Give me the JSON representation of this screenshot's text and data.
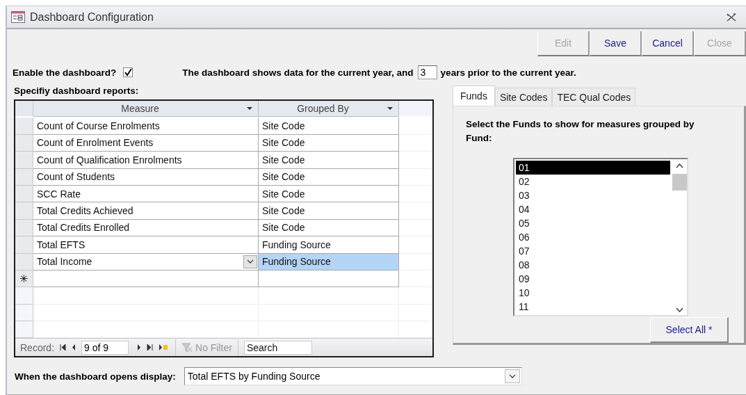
{
  "window": {
    "title": "Dashboard Configuration"
  },
  "buttons": [
    {
      "label": "Edit",
      "disabled": true
    },
    {
      "label": "Save",
      "disabled": false
    },
    {
      "label": "Cancel",
      "disabled": false
    },
    {
      "label": "Close",
      "disabled": true
    }
  ],
  "enable": {
    "label": "Enable the dashboard?",
    "checked": true
  },
  "years": {
    "before": "The dashboard shows data for the current year, and",
    "value": "3",
    "after": "years prior to the current year."
  },
  "reports": {
    "label": "Specifiy dashboard reports:",
    "columns": [
      "Measure",
      "Grouped By"
    ],
    "rows": [
      {
        "measure": "Count of Course Enrolments",
        "grouped_by": "Site Code",
        "selected": false
      },
      {
        "measure": "Count of Enrolment Events",
        "grouped_by": "Site Code",
        "selected": false
      },
      {
        "measure": "Count of Qualification Enrolments",
        "grouped_by": "Site Code",
        "selected": false
      },
      {
        "measure": "Count of Students",
        "grouped_by": "Site Code",
        "selected": false
      },
      {
        "measure": "SCC Rate",
        "grouped_by": "Site Code",
        "selected": false
      },
      {
        "measure": "Total Credits Achieved",
        "grouped_by": "Site Code",
        "selected": false
      },
      {
        "measure": "Total Credits Enrolled",
        "grouped_by": "Site Code",
        "selected": false
      },
      {
        "measure": "Total EFTS",
        "grouped_by": "Funding Source",
        "selected": false
      },
      {
        "measure": "Total Income",
        "grouped_by": "Funding Source",
        "selected": true
      }
    ],
    "new_row_marker": "✳",
    "navigation": {
      "label": "Record:",
      "position": "9 of 9",
      "filter": "No Filter",
      "search_placeholder": "Search"
    }
  },
  "tabs": [
    {
      "label": "Funds",
      "selected": true
    },
    {
      "label": "Site Codes",
      "selected": false
    },
    {
      "label": "TEC Qual Codes",
      "selected": false
    }
  ],
  "funds": {
    "prompt": "Select the Funds to show  for measures grouped by Fund:",
    "items": [
      {
        "label": "01",
        "selected": true
      },
      {
        "label": "02",
        "selected": false
      },
      {
        "label": "03",
        "selected": false
      },
      {
        "label": "04",
        "selected": false
      },
      {
        "label": "05",
        "selected": false
      },
      {
        "label": "06",
        "selected": false
      },
      {
        "label": "07",
        "selected": false
      },
      {
        "label": "08",
        "selected": false
      },
      {
        "label": "09",
        "selected": false
      },
      {
        "label": "10",
        "selected": false
      },
      {
        "label": "11",
        "selected": false
      }
    ],
    "select_all": "Select All *"
  },
  "open_display": {
    "label": "When the dashboard opens display:",
    "value": "Total EFTS by Funding Source"
  }
}
